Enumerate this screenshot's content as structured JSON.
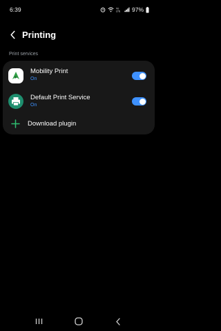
{
  "status_bar": {
    "time": "6:39",
    "battery": "97%"
  },
  "header": {
    "title": "Printing"
  },
  "section": {
    "label": "Print services"
  },
  "services": [
    {
      "name": "Mobility Print",
      "status": "On",
      "enabled": true,
      "icon": "mobility-print-icon"
    },
    {
      "name": "Default Print Service",
      "status": "On",
      "enabled": true,
      "icon": "printer-icon"
    }
  ],
  "download": {
    "label": "Download plugin"
  },
  "colors": {
    "accent": "#3e91ff",
    "card": "#181818",
    "plus": "#2fbf71",
    "mobility_icon_bg": "#ffffff",
    "mobility_icon_fg": "#2f9e44",
    "printer_icon_bg": "#1e8e6e"
  }
}
